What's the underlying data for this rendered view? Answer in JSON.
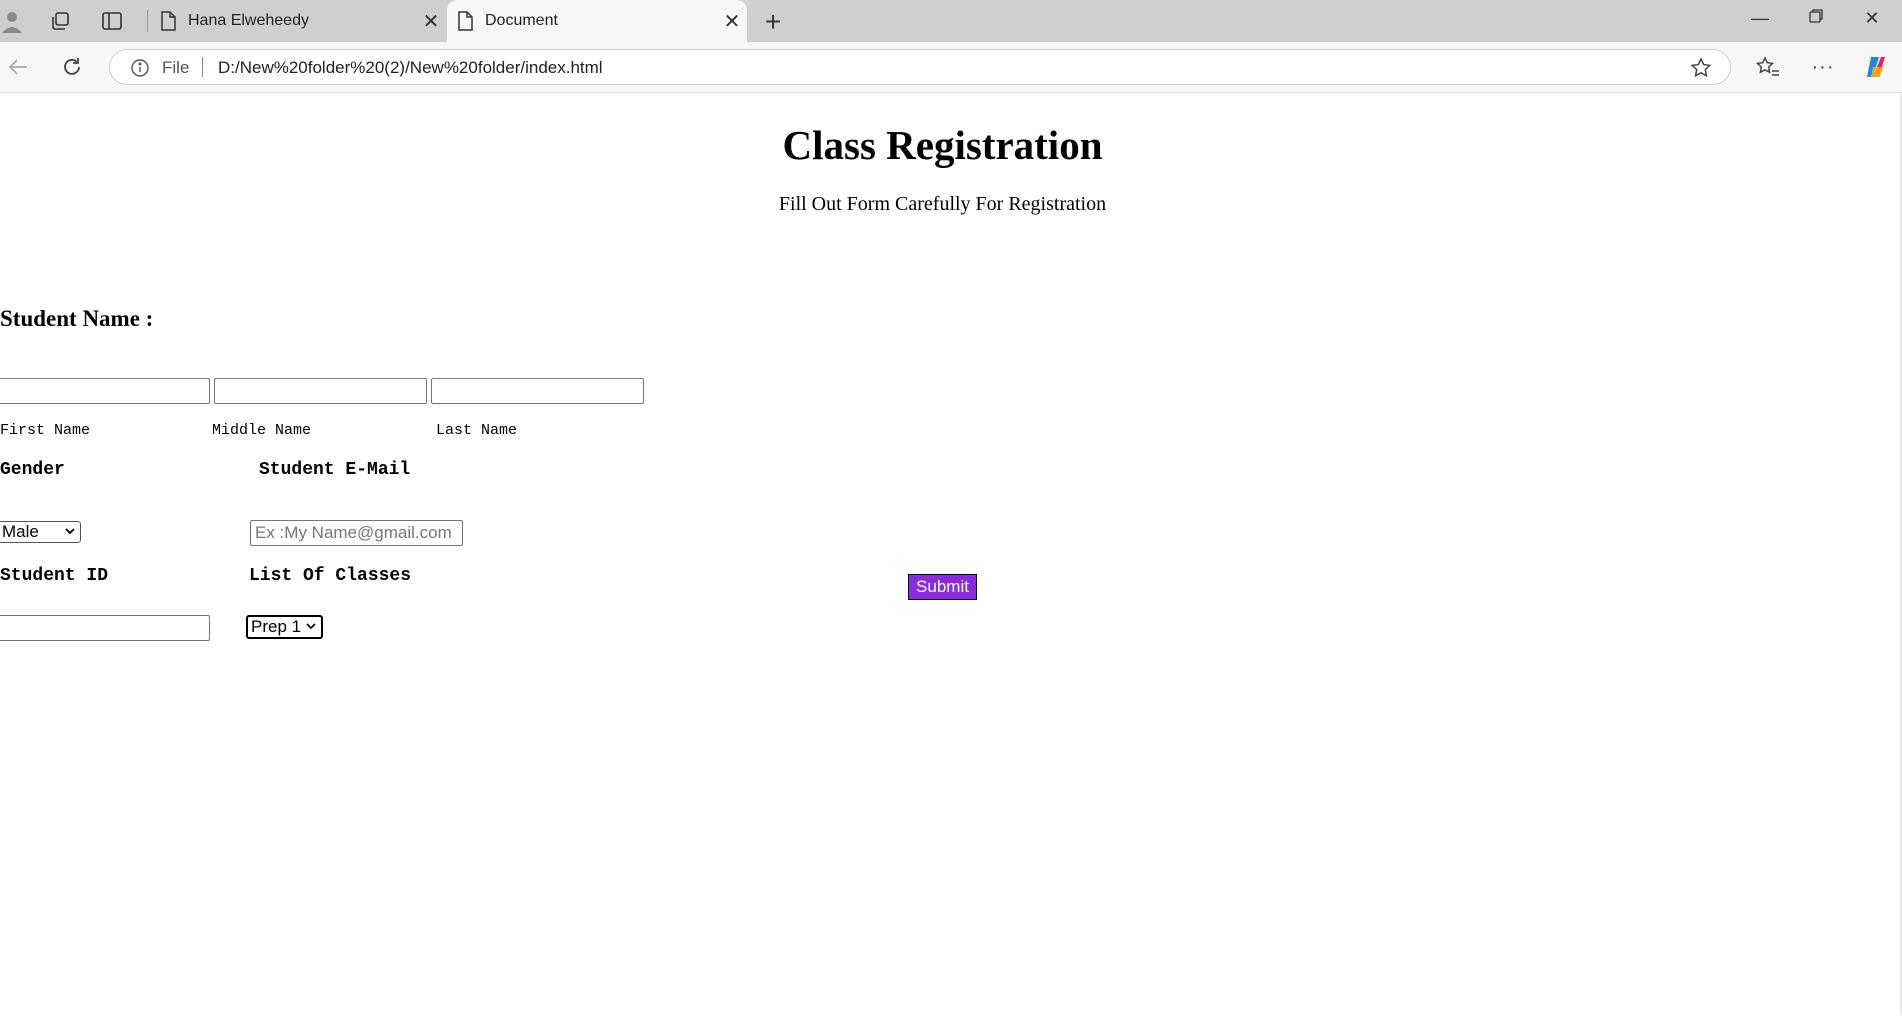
{
  "browser": {
    "tabs": [
      {
        "title": "Hana Elweheedy",
        "active": false
      },
      {
        "title": "Document",
        "active": true
      }
    ],
    "address": {
      "scheme_label": "File",
      "url": "D:/New%20folder%20(2)/New%20folder/index.html"
    },
    "icons": {
      "profile": "profile-icon",
      "workspaces": "workspaces-icon",
      "tab_actions": "tab-actions-icon",
      "back": "back-arrow-icon",
      "refresh": "refresh-icon",
      "info": "info-icon",
      "favorite": "star-icon",
      "favorites": "favorites-icon",
      "more": "more-icon",
      "copilot": "copilot-icon"
    }
  },
  "page": {
    "title": "Class Registration",
    "subtitle": "Fill Out Form Carefully For Registration",
    "student_name_label": "Student Name :",
    "first_name_label": "First Name",
    "middle_name_label": "Middle Name",
    "last_name_label": "Last Name",
    "gender_label": "Gender",
    "gender_value": "Male",
    "email_label": "Student E-Mail",
    "email_placeholder": "Ex :My Name@gmail.com",
    "student_id_label": "Student ID",
    "classes_label": "List Of Classes",
    "classes_value": "Prep 1",
    "submit_label": "Submit",
    "submit_color": "#8a2be2"
  }
}
